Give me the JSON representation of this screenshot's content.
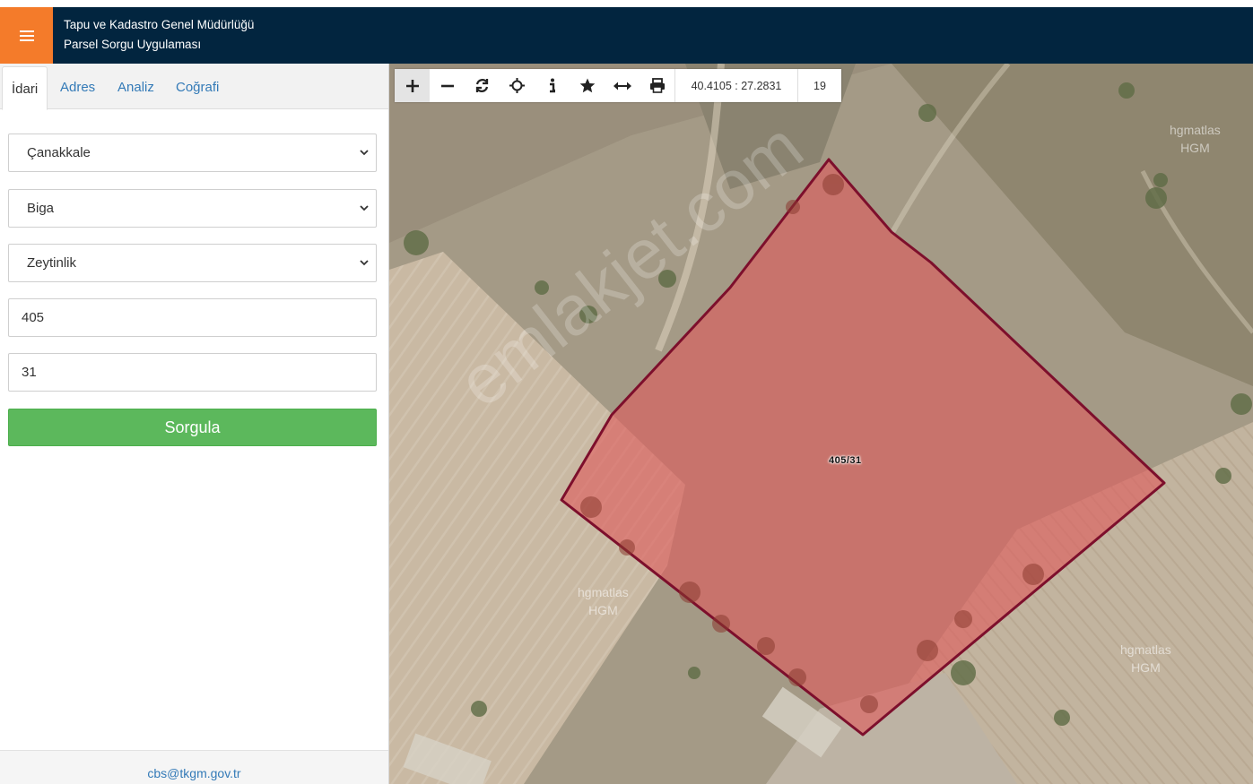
{
  "header": {
    "title_line1": "Tapu ve Kadastro Genel Müdürlüğü",
    "title_line2": "Parsel Sorgu Uygulaması",
    "menu_icon": "hamburger-icon",
    "accent_color": "#f47b2a",
    "bar_color": "#02253f"
  },
  "tabs": [
    {
      "label": "İdari",
      "active": true
    },
    {
      "label": "Adres",
      "active": false
    },
    {
      "label": "Analiz",
      "active": false
    },
    {
      "label": "Coğrafi",
      "active": false
    }
  ],
  "form": {
    "il": "Çanakkale",
    "ilce": "Biga",
    "mahalle": "Zeytinlik",
    "ada": "405",
    "parsel": "31",
    "submit_label": "Sorgula",
    "submit_color": "#5cb85c"
  },
  "footer": {
    "email": "cbs@tkgm.gov.tr"
  },
  "map": {
    "coordinates": "40.4105 : 27.2831",
    "zoom": "19",
    "parcel_label": "405/31",
    "watermark_line1": "hgmatlas",
    "watermark_line2": "HGM",
    "site_watermark": "emlakjet.com",
    "tools": [
      "zoom-in-icon",
      "zoom-out-icon",
      "refresh-icon",
      "locate-icon",
      "info-icon",
      "favorite-icon",
      "measure-icon",
      "print-icon"
    ]
  }
}
